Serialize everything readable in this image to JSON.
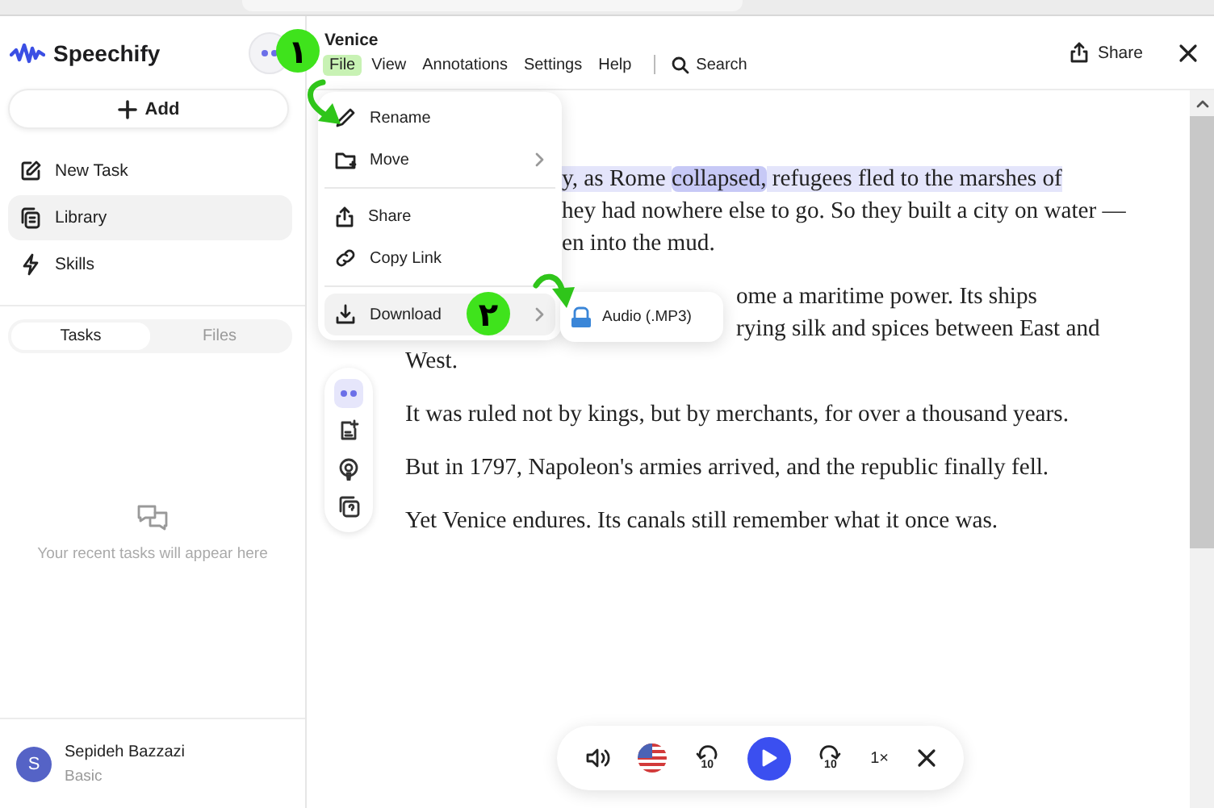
{
  "app": {
    "name": "Speechify"
  },
  "sidebar": {
    "add_button": "Add",
    "nav": [
      {
        "label": "New Task",
        "selected": false
      },
      {
        "label": "Library",
        "selected": true
      },
      {
        "label": "Skills",
        "selected": false
      }
    ],
    "tabs": [
      {
        "label": "Tasks",
        "selected": true
      },
      {
        "label": "Files",
        "selected": false
      }
    ],
    "empty_state": "Your recent tasks will appear here",
    "user": {
      "initial": "S",
      "name": "Sepideh Bazzazi",
      "plan": "Basic"
    }
  },
  "document": {
    "title": "Venice",
    "menu": [
      {
        "label": "File",
        "selected": true
      },
      {
        "label": "View",
        "selected": false
      },
      {
        "label": "Annotations",
        "selected": false
      },
      {
        "label": "Settings",
        "selected": false
      },
      {
        "label": "Help",
        "selected": false
      }
    ],
    "search": "Search",
    "share": "Share"
  },
  "file_menu": {
    "groups": [
      [
        {
          "label": "Rename",
          "submenu": false,
          "selected": false
        },
        {
          "label": "Move",
          "submenu": true,
          "selected": false
        }
      ],
      [
        {
          "label": "Share",
          "submenu": false,
          "selected": false
        },
        {
          "label": "Copy Link",
          "submenu": false,
          "selected": false
        }
      ],
      [
        {
          "label": "Download",
          "submenu": true,
          "selected": true
        }
      ]
    ],
    "submenu": [
      {
        "label": "Audio (.MP3)"
      }
    ]
  },
  "annotations": [
    {
      "label": "۱"
    },
    {
      "label": "۲"
    }
  ],
  "article": {
    "paragraphs": [
      {
        "lines": [
          {
            "kind": "menu",
            "segments": [
              {
                "text": "y, as Rome ",
                "highlighted": true,
                "current": false
              },
              {
                "text": "collapsed,",
                "highlighted": true,
                "current": true
              },
              {
                "text": " refugees fled to the marshes of",
                "highlighted": true,
                "current": false
              }
            ]
          },
          {
            "kind": "menu",
            "segments": [
              {
                "text": "hey had nowhere else to go. So they built a city on water —",
                "highlighted": false,
                "current": false
              }
            ]
          },
          {
            "kind": "menu",
            "segments": [
              {
                "text": "en into the mud.",
                "highlighted": false,
                "current": false
              }
            ]
          }
        ]
      },
      {
        "lines": [
          {
            "kind": "submenu",
            "segments": [
              {
                "text": "ome a maritime power. Its ships",
                "highlighted": false,
                "current": false
              }
            ]
          },
          {
            "kind": "submenu",
            "segments": [
              {
                "text": "rying silk and spices between East and",
                "highlighted": false,
                "current": false
              }
            ]
          },
          {
            "kind": "full",
            "segments": [
              {
                "text": "West.",
                "highlighted": false,
                "current": false
              }
            ]
          }
        ]
      },
      {
        "lines": [
          {
            "kind": "full",
            "segments": [
              {
                "text": "It was ruled not by kings, but by merchants, for over a thousand years.",
                "highlighted": false,
                "current": false
              }
            ]
          }
        ]
      },
      {
        "lines": [
          {
            "kind": "full",
            "segments": [
              {
                "text": "But in 1797, Napoleon's armies arrived, and the republic finally fell.",
                "highlighted": false,
                "current": false
              }
            ]
          }
        ]
      },
      {
        "lines": [
          {
            "kind": "full",
            "segments": [
              {
                "text": "Yet Venice endures. Its canals still remember what it once was.",
                "highlighted": false,
                "current": false
              }
            ]
          }
        ]
      }
    ]
  },
  "player": {
    "rewind": "10",
    "forward": "10",
    "speed": "1×"
  }
}
